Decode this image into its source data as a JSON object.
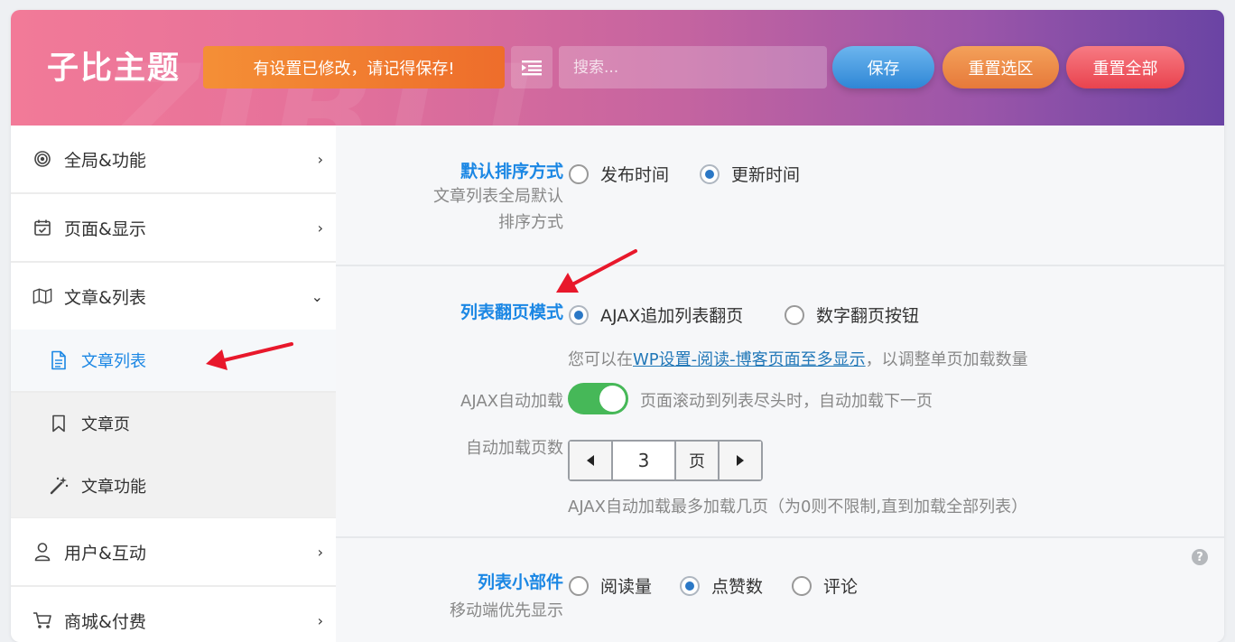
{
  "header": {
    "brand": "子比主题",
    "warning": "有设置已修改，请记得保存!",
    "search_placeholder": "搜索...",
    "save_label": "保存",
    "reset_section_label": "重置选区",
    "reset_all_label": "重置全部",
    "watermark": "ZIBLL"
  },
  "sidebar": {
    "items": [
      {
        "label": "全局&功能",
        "icon": "target-icon",
        "chevron": "›"
      },
      {
        "label": "页面&显示",
        "icon": "calendar-check-icon",
        "chevron": "›"
      },
      {
        "label": "文章&列表",
        "icon": "map-icon",
        "chevron": "⌄"
      },
      {
        "label": "用户&互动",
        "icon": "user-icon",
        "chevron": "›"
      },
      {
        "label": "商城&付费",
        "icon": "cart-icon",
        "chevron": "›"
      }
    ],
    "subitems": [
      {
        "label": "文章列表",
        "icon": "document-icon",
        "active": true
      },
      {
        "label": "文章页",
        "icon": "bookmark-icon"
      },
      {
        "label": "文章功能",
        "icon": "magic-wand-icon"
      }
    ]
  },
  "content": {
    "sort": {
      "title": "默认排序方式",
      "desc_line1": "文章列表全局默认",
      "desc_line2": "排序方式",
      "options": [
        "发布时间",
        "更新时间"
      ],
      "selected": "更新时间"
    },
    "paging": {
      "title": "列表翻页模式",
      "options": [
        "AJAX追加列表翻页",
        "数字翻页按钮"
      ],
      "selected": "AJAX追加列表翻页",
      "hint_prefix": "您可以在",
      "hint_link": "WP设置-阅读-博客页面至多显示",
      "hint_suffix": "，以调整单页加载数量"
    },
    "autoload": {
      "label": "AJAX自动加载",
      "enabled": true,
      "desc": "页面滚动到列表尽头时，自动加载下一页"
    },
    "autopages": {
      "label": "自动加载页数",
      "value": "3",
      "unit": "页",
      "hint": "AJAX自动加载最多加载几页（为0则不限制,直到加载全部列表）"
    },
    "widgets": {
      "title": "列表小部件",
      "desc": "移动端优先显示",
      "options": [
        "阅读量",
        "点赞数",
        "评论"
      ],
      "selected": "点赞数",
      "help": "?"
    }
  },
  "colors": {
    "accent": "#1b87e4",
    "toggle_on": "#46b858",
    "annotation_arrow": "#e8182b"
  }
}
